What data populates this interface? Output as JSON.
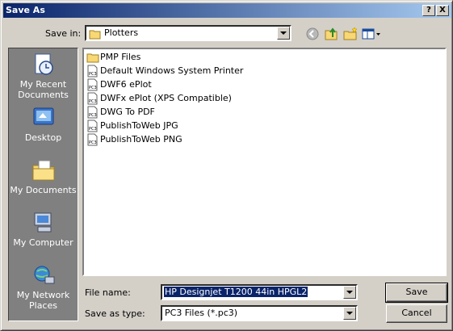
{
  "window": {
    "title": "Save As"
  },
  "titlebar_buttons": {
    "help": "?",
    "close": "X"
  },
  "save_in": {
    "label": "Save in:",
    "value": "Plotters"
  },
  "places": [
    {
      "label": "My Recent Documents",
      "icon": "recent-documents-icon"
    },
    {
      "label": "Desktop",
      "icon": "desktop-icon"
    },
    {
      "label": "My Documents",
      "icon": "my-documents-icon"
    },
    {
      "label": "My Computer",
      "icon": "my-computer-icon"
    },
    {
      "label": "My Network Places",
      "icon": "network-places-icon"
    }
  ],
  "files": [
    {
      "name": "PMP Files",
      "type": "folder"
    },
    {
      "name": "Default Windows System Printer",
      "type": "pc3"
    },
    {
      "name": "DWF6 ePlot",
      "type": "pc3"
    },
    {
      "name": "DWFx ePlot (XPS Compatible)",
      "type": "pc3"
    },
    {
      "name": "DWG To PDF",
      "type": "pc3"
    },
    {
      "name": "PublishToWeb JPG",
      "type": "pc3"
    },
    {
      "name": "PublishToWeb PNG",
      "type": "pc3"
    }
  ],
  "file_name": {
    "label": "File name:",
    "value": "HP Designjet T1200 44in HPGL2"
  },
  "save_as_type": {
    "label": "Save as type:",
    "value": "PC3 Files (*.pc3)"
  },
  "buttons": {
    "save": "Save",
    "cancel": "Cancel"
  },
  "colors": {
    "titlebar_start": "#0a246a",
    "titlebar_end": "#a6caf0",
    "places_bg": "#808080",
    "face": "#d4d0c8"
  }
}
